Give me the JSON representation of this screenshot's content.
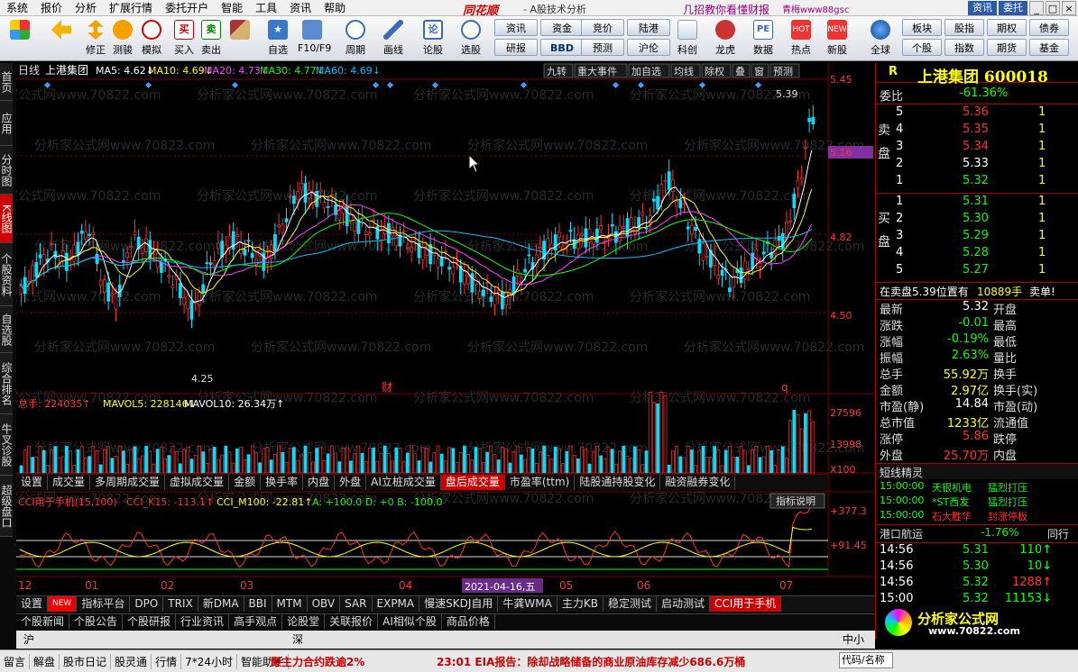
{
  "menu": {
    "items": [
      "系统",
      "报价",
      "分析",
      "扩展行情",
      "委托开户",
      "智能",
      "工具",
      "资讯",
      "帮助"
    ],
    "logo": "同花顺",
    "sub": "- A股技术分析",
    "promo": "几招教你看懂财报",
    "user": "青梅www88gsc",
    "btn_news": "资讯",
    "btn_trade": "委托"
  },
  "toolbar": {
    "buttons": [
      {
        "label": "",
        "icon": "grid-icon"
      },
      {
        "label": "",
        "icon": "back-arrow-icon"
      },
      {
        "label": "修正",
        "icon": "up-down-arrow-icon"
      },
      {
        "label": "测骏",
        "icon": "clock-icon"
      },
      {
        "label": "模拟",
        "icon": "clock2-icon"
      },
      {
        "label": "买入",
        "icon": "buy-icon"
      },
      {
        "label": "卖出",
        "icon": "sell-icon"
      },
      {
        "label": "",
        "icon": "hammer-icon"
      },
      {
        "label": "自选",
        "icon": "star-icon"
      },
      {
        "label": "F10/F9",
        "icon": "doc-icon"
      },
      {
        "label": "周期",
        "icon": "cycle-icon"
      },
      {
        "label": "画线",
        "icon": "pen-icon"
      },
      {
        "label": "论股",
        "icon": "chat-icon"
      },
      {
        "label": "选股",
        "icon": "select-icon"
      }
    ],
    "grid1": [
      "资讯",
      "资金",
      "研报",
      "BBD"
    ],
    "grid2": [
      "竞价",
      "陆港",
      "预测",
      "沪伦"
    ],
    "buttons2": [
      {
        "label": "科创",
        "icon": "chart-icon"
      },
      {
        "label": "龙虎",
        "icon": "dragon-icon"
      },
      {
        "label": "数据",
        "icon": "pe-icon"
      },
      {
        "label": "热点",
        "icon": "hot-icon"
      },
      {
        "label": "新股",
        "icon": "new-icon"
      },
      {
        "label": "全球",
        "icon": "globe-icon"
      }
    ],
    "grid3": [
      "板块",
      "股指",
      "个股",
      "指数"
    ],
    "grid4": [
      "期权",
      "期货",
      "债券",
      "基金"
    ]
  },
  "leftnav": [
    "首页",
    "应用",
    "分时图",
    "K线图",
    "个股资料",
    "自选股",
    "综合排名",
    "牛叉诊股",
    "超级盘口"
  ],
  "kline": {
    "period": "日线",
    "name": "上港集团",
    "ma": [
      {
        "label": "MA5:",
        "value": "4.62",
        "color": "#ffffff"
      },
      {
        "label": "MA10:",
        "value": "4.69",
        "color": "#ffff00"
      },
      {
        "label": "MA20:",
        "value": "4.73",
        "color": "#ff40ff"
      },
      {
        "label": "MA30:",
        "value": "4.77",
        "color": "#00ff00"
      },
      {
        "label": "MA60:",
        "value": "4.69",
        "color": "#00c0ff"
      }
    ],
    "tools": [
      "九转",
      "重大事件",
      "加自选",
      "均线",
      "除权",
      "叠",
      "窗",
      "预测"
    ],
    "prices": [
      "5.45",
      "5.16",
      "4.82",
      "4.50"
    ],
    "hi_label": "5.39",
    "lo_label": "4.25",
    "marker1": "财",
    "marker2": "q"
  },
  "volume": {
    "label": "总手: 224035↑",
    "mav5": "MAVOL5: 228146↓",
    "mav10": "MAVOL10: 26.34万↑",
    "scale": [
      "27596",
      "13998",
      "X100"
    ],
    "tabs": [
      "设置",
      "成交量",
      "多周期成交量",
      "虚拟成交量",
      "金额",
      "换手率",
      "内盘",
      "外盘",
      "AI立桩成交量",
      "盘后成交量",
      "市盈率(ttm)",
      "陆股通持股变化",
      "融资融券变化"
    ],
    "active_tab": "盘后成交量"
  },
  "cci": {
    "title": "CCI用于手机(15,100)",
    "k15": "CCI_K15: -113.1↑",
    "m100": "CCI_M100: -22.81↑",
    "abd": "A: +100.0  D: +0  B: -100.0",
    "explain": "指标说明",
    "scale": [
      "+377.3",
      "+91.45"
    ]
  },
  "xaxis": {
    "labels": [
      "12",
      "01",
      "02",
      "03",
      "04",
      "05",
      "06",
      "07"
    ],
    "cursor_date": "2021-04-16,五"
  },
  "indtabs": [
    "设置",
    "NEW",
    "指标平台",
    "DPO",
    "TRIX",
    "新DMA",
    "BBI",
    "MTM",
    "OBV",
    "SAR",
    "EXPMA",
    "慢速SKDJ自用",
    "牛龚WMA",
    "主力KB",
    "稳定测试",
    "启动测试",
    "CCI用于手机"
  ],
  "infotabs": [
    "个股新闻",
    "个股公告",
    "个股研报",
    "行业资讯",
    "高手观点",
    "论股堂",
    "关联报价",
    "AI相似个股",
    "商品价格"
  ],
  "rp": {
    "flag": "R",
    "title": "上港集团 600018",
    "weibi_label": "委比",
    "weibi": "-61.36%",
    "sell_side": "卖盘",
    "buy_side": "买盘",
    "sells": [
      {
        "n": "5",
        "p": "5.36",
        "v": "1"
      },
      {
        "n": "4",
        "p": "5.35",
        "v": "1"
      },
      {
        "n": "3",
        "p": "5.34",
        "v": "1"
      },
      {
        "n": "2",
        "p": "5.33",
        "v": "1"
      },
      {
        "n": "1",
        "p": "5.32",
        "v": "1"
      }
    ],
    "buys": [
      {
        "n": "1",
        "p": "5.31",
        "v": "1"
      },
      {
        "n": "2",
        "p": "5.30",
        "v": "1"
      },
      {
        "n": "3",
        "p": "5.29",
        "v": "1"
      },
      {
        "n": "4",
        "p": "5.28",
        "v": "1"
      },
      {
        "n": "5",
        "p": "5.27",
        "v": "1"
      }
    ],
    "alert1": "在卖盘5.39位置有",
    "alert2": "10889手",
    "alert3": "卖单!",
    "stats": [
      [
        "最新",
        "5.32",
        "开盘",
        ""
      ],
      [
        "涨跌",
        "-0.01",
        "最高",
        ""
      ],
      [
        "涨幅",
        "-0.19%",
        "最低",
        ""
      ],
      [
        "振幅",
        "2.63%",
        "量比",
        ""
      ],
      [
        "总手",
        "55.92万",
        "换手",
        ""
      ],
      [
        "金额",
        "2.97亿",
        "换手(实)",
        ""
      ],
      [
        "市盈(静)",
        "14.84",
        "市盈(动)",
        ""
      ],
      [
        "总市值",
        "1233亿",
        "流通值",
        ""
      ],
      [
        "涨停",
        "5.86",
        "跌停",
        ""
      ],
      [
        "外盘",
        "25.70万",
        "内盘",
        ""
      ]
    ],
    "short_title": "短线精灵",
    "short": [
      [
        "15:00:00",
        "天银机电",
        "猛烈打压"
      ],
      [
        "15:00:00",
        "*ST西发",
        "猛烈打压"
      ],
      [
        "15:00:00",
        "石大胜华",
        "封涨停板"
      ]
    ],
    "hk_label": "港口航运",
    "hk_val": "-1.76%",
    "ticks": [
      [
        "14:56",
        "5.31",
        "110"
      ],
      [
        "14:56",
        "5.30",
        "10"
      ],
      [
        "14:56",
        "5.32",
        "1288"
      ],
      [
        "15:00",
        "5.32",
        "11153"
      ]
    ],
    "tick_header": "同行"
  },
  "status": {
    "left": [
      "沪",
      "深",
      "中小"
    ],
    "items": [
      "留言",
      "解盘",
      "股市日记",
      "股灵通",
      "行情",
      "7*24小时",
      "智能助手"
    ],
    "ticker": "聚主力合约跌逾2%",
    "news": "23:01 EIA报告：除却战略储备的商业原油库存减少686.6万桶",
    "search": "代码/名称",
    "brand": "分析家公式网",
    "url": "www.70822.com"
  },
  "watermark": "分析家公式网www.70822.com"
}
